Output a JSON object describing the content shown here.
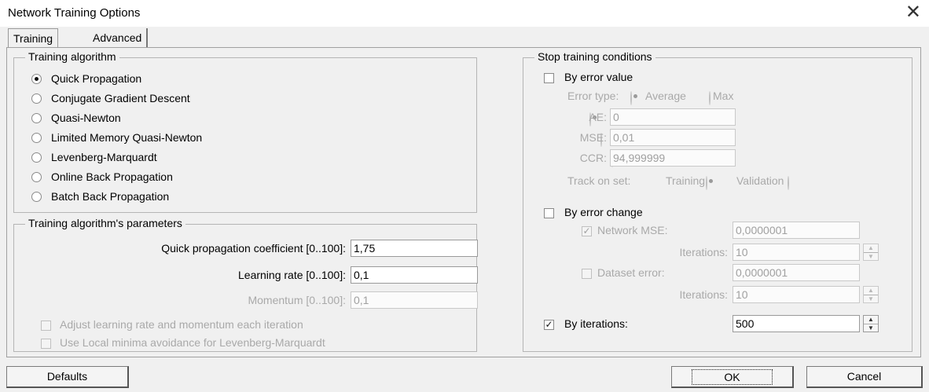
{
  "window": {
    "title": "Network Training Options",
    "close_glyph": "✕"
  },
  "tabs": [
    {
      "label": "Training",
      "active": true
    },
    {
      "label": "Advanced",
      "active": false
    }
  ],
  "training_algorithm": {
    "legend": "Training algorithm",
    "options": [
      {
        "label": "Quick Propagation",
        "checked": true
      },
      {
        "label": "Conjugate Gradient Descent",
        "checked": false
      },
      {
        "label": "Quasi-Newton",
        "checked": false
      },
      {
        "label": "Limited Memory Quasi-Newton",
        "checked": false
      },
      {
        "label": "Levenberg-Marquardt",
        "checked": false
      },
      {
        "label": "Online Back Propagation",
        "checked": false
      },
      {
        "label": "Batch Back Propagation",
        "checked": false
      }
    ]
  },
  "params": {
    "legend": "Training algorithm's parameters",
    "qp_coef_label": "Quick propagation coefficient [0..100]:",
    "qp_coef_value": "1,75",
    "lr_label": "Learning rate [0..100]:",
    "lr_value": "0,1",
    "momentum_label": "Momentum [0..100]:",
    "momentum_value": "0,1",
    "adjust_label": "Adjust learning rate and momentum each iteration",
    "local_minima_label": "Use Local minima avoidance for Levenberg-Marquardt"
  },
  "stop": {
    "legend": "Stop training conditions",
    "by_error_value": {
      "label": "By error value",
      "checked": false,
      "error_type_label": "Error type:",
      "average_label": "Average",
      "max_label": "Max",
      "ae_label": "AE:",
      "ae_value": "0",
      "mse_label": "MSE:",
      "mse_value": "0,01",
      "ccr_label": "CCR:",
      "ccr_value": "94,999999",
      "track_label": "Track on set:",
      "training_label": "Training",
      "validation_label": "Validation"
    },
    "by_error_change": {
      "label": "By error change",
      "checked": false,
      "network_mse_label": "Network MSE:",
      "network_mse_value": "0,0000001",
      "network_mse_checked": true,
      "iterations_label": "Iterations:",
      "iterations_value": "10",
      "dataset_error_label": "Dataset error:",
      "dataset_error_value": "0,0000001",
      "dataset_error_checked": false,
      "iterations2_label": "Iterations:",
      "iterations2_value": "10"
    },
    "by_iterations": {
      "label": "By iterations:",
      "checked": true,
      "value": "500"
    }
  },
  "buttons": {
    "defaults": "Defaults",
    "ok": "OK",
    "cancel": "Cancel"
  },
  "glyphs": {
    "check": "✓",
    "spin_up": "▲",
    "spin_down": "▼"
  }
}
